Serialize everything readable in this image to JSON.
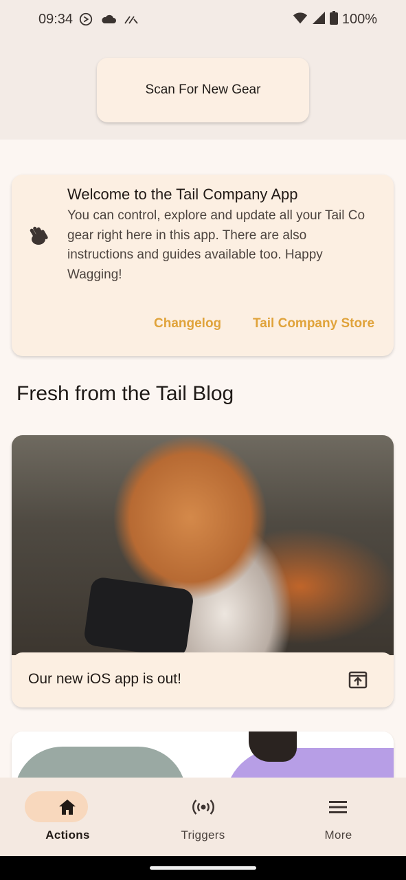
{
  "status_bar": {
    "time": "09:34",
    "battery": "100%"
  },
  "header": {
    "scan_button_label": "Scan For New Gear"
  },
  "welcome_card": {
    "title": "Welcome to the Tail Company App",
    "body": "You can control, explore and update all your Tail Co gear right here in this app. There are also instructions and guides available too. Happy Wagging!",
    "changelog_label": "Changelog",
    "store_label": "Tail Company Store",
    "icon": "waving-hand-icon"
  },
  "blog": {
    "section_title": "Fresh from the Tail Blog",
    "posts": [
      {
        "caption": "Our new iOS app is out!",
        "icon": "open-in-new-icon"
      }
    ]
  },
  "bottom_nav": {
    "items": [
      {
        "label": "Actions",
        "icon": "home-icon",
        "active": true
      },
      {
        "label": "Triggers",
        "icon": "broadcast-icon",
        "active": false
      },
      {
        "label": "More",
        "icon": "menu-icon",
        "active": false
      }
    ]
  },
  "colors": {
    "accent": "#e0a33b",
    "card": "#fcefe2",
    "nav_active_pill": "#f8d8bd"
  }
}
